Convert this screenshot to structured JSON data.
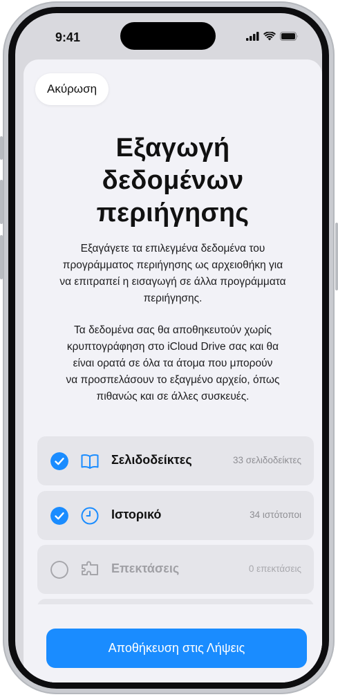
{
  "status_bar": {
    "time": "9:41",
    "icons": [
      "cellular-signal-icon",
      "wifi-icon",
      "battery-icon"
    ]
  },
  "sheet": {
    "cancel_label": "Ακύρωση",
    "title_lines": [
      "Εξαγωγή",
      "δεδομένων",
      "περιήγησης"
    ],
    "description_lines": [
      "Εξαγάγετε τα επιλεγμένα δεδομένα του",
      "προγράμματος περιήγησης ως αρχειοθήκη για",
      "να επιτραπεί η εισαγωγή σε άλλα προγράμματα",
      "περιήγησης."
    ],
    "warning_lines": [
      "Τα δεδομένα σας θα αποθηκευτούν χωρίς",
      "κρυπτογράφηση στο iCloud Drive σας και θα",
      "είναι ορατά σε όλα τα άτομα που μπορούν",
      "να προσπελάσουν το εξαγμένο αρχείο, όπως",
      "πιθανώς και σε άλλες συσκευές."
    ],
    "items": [
      {
        "label": "Σελιδοδείκτες",
        "count": "33 σελιδοδείκτες",
        "checked": true,
        "icon": "book-icon"
      },
      {
        "label": "Ιστορικό",
        "count": "34 ιστότοποι",
        "checked": true,
        "icon": "clock-icon"
      },
      {
        "label": "Επεκτάσεις",
        "count": "0 επεκτάσεις",
        "checked": false,
        "icon": "extension-puzzle-icon"
      }
    ],
    "save_label": "Αποθήκευση στις Λήψεις"
  },
  "colors": {
    "accent": "#1a8cff",
    "sheet_background": "#f2f2f7",
    "row_background": "#e5e5ea",
    "secondary_text": "#8e8e93"
  }
}
